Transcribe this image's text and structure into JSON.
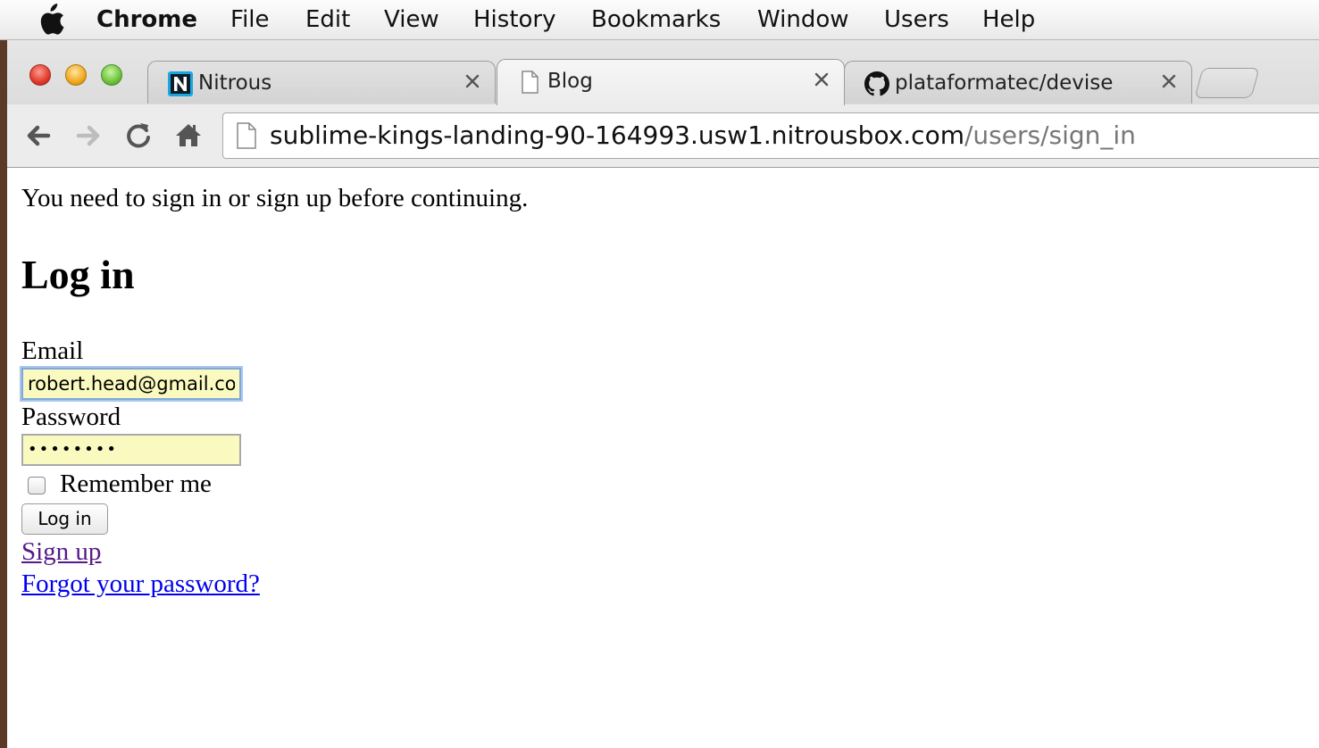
{
  "menubar": {
    "items": [
      "Chrome",
      "File",
      "Edit",
      "View",
      "History",
      "Bookmarks",
      "Window",
      "Users",
      "Help"
    ]
  },
  "tabs": [
    {
      "title": "Nitrous",
      "icon": "nitrous-logo-icon",
      "active": false
    },
    {
      "title": "Blog",
      "icon": "page-icon",
      "active": true
    },
    {
      "title": "plataformatec/devise",
      "icon": "github-icon",
      "active": false
    }
  ],
  "address_bar": {
    "host": "sublime-kings-landing-90-164993.usw1.nitrousbox.com",
    "path": "/users/sign_in"
  },
  "page": {
    "notice": "You need to sign in or sign up before continuing.",
    "heading": "Log in",
    "email_label": "Email",
    "email_value": "robert.head@gmail.co",
    "password_label": "Password",
    "password_value": "••••••••",
    "remember_label": "Remember me",
    "remember_checked": false,
    "submit_label": "Log in",
    "signup_link": "Sign up",
    "forgot_link": "Forgot your password?"
  },
  "colors": {
    "autofill_bg": "#fafac0",
    "focus_ring": "#7fa8dc",
    "visited_link": "#551a8b",
    "link": "#0000ee"
  }
}
